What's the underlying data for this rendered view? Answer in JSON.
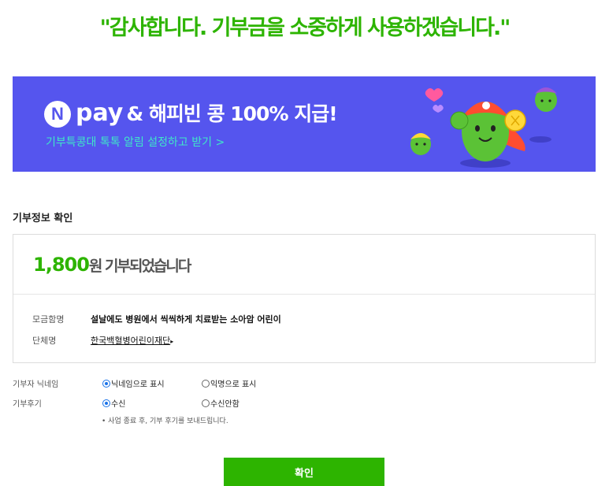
{
  "thanks_message": "\"감사합니다. 기부금을 소중하게 사용하겠습니다.\"",
  "banner": {
    "logo_letter": "N",
    "pay_word": "pay",
    "headline_rest": "& 해피빈 콩 100% 지급!",
    "subtext": "기부특콩대 톡톡 알림 설정하고 받기 >",
    "bg_color": "#5555ee",
    "sub_color": "#3fe8c8"
  },
  "section_title": "기부정보 확인",
  "donation": {
    "amount": "1,800",
    "amount_suffix": "원 기부되었습니다",
    "fundraiser_label": "모금함명",
    "fundraiser_name": "설날에도 병원에서 씩씩하게 치료받는 소아암 어린이",
    "org_label": "단체명",
    "org_name": "한국백혈병어린이재단",
    "org_arrow": "▸"
  },
  "nickname": {
    "label": "기부자 닉네임",
    "options": [
      "닉네임으로 표시",
      "익명으로 표시"
    ],
    "selected": "닉네임으로 표시"
  },
  "review": {
    "label": "기부후기",
    "options": [
      "수신",
      "수신안함"
    ],
    "selected": "수신",
    "note": "• 사업 종료 후, 기부 후기를 보내드립니다."
  },
  "confirm_label": "확인",
  "accent_color": "#2db400"
}
